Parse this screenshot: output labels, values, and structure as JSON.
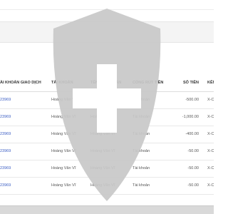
{
  "table": {
    "headers": [
      "ÀI KHOẢN GIAO DỊCH",
      "TÀI KHOẢN",
      "TÊN TÀI KHOẢN",
      "CỔNG RÚT TIỀN",
      "SỐ TIỀN",
      "KÊN"
    ],
    "rows": [
      [
        "23969",
        "Hoàng Văn Vĩ",
        "Hoàng Văn Vĩ",
        "Tài khoản",
        "-500.00",
        "X-C"
      ],
      [
        "23969",
        "Hoàng Văn Vĩ",
        "Hoàng Văn Vĩ",
        "Tài khoản",
        "-1,000.00",
        "X-C"
      ],
      [
        "23969",
        "Hoàng Văn Vĩ",
        "Hoàng Văn Vĩ",
        "Tài khoản",
        "-400.00",
        "X-C"
      ],
      [
        "23969",
        "Hoàng Văn Vĩ",
        "Hoàng Văn Vĩ",
        "Tài khoản",
        "-50.00",
        "X-C"
      ],
      [
        "23969",
        "Hoàng Văn Vĩ",
        "Hoàng Văn Vĩ",
        "Tài khoản",
        "-50.00",
        "X-C"
      ],
      [
        "23969",
        "Hoàng Văn Vĩ",
        "Hoàng Văn Vĩ",
        "Tài khoản",
        "-50.00",
        "X-C"
      ]
    ]
  },
  "overlay": {
    "icon": "shield-plus-icon",
    "shield_color": "#c8c8c8",
    "cross_color": "#ffffff"
  },
  "colors": {
    "link": "#3d5fc4",
    "header_band": "#f4f4f4",
    "bottom_bar": "#d9d9d9"
  }
}
